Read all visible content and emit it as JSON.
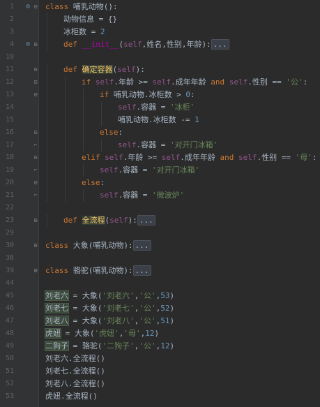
{
  "editor": {
    "lines": [
      {
        "n": "1",
        "icon": "override",
        "fold": "minus",
        "indent": 0,
        "tokens": [
          {
            "t": "class ",
            "c": "kw"
          },
          {
            "t": "哺乳动物",
            "c": "plain"
          },
          {
            "t": "():",
            "c": "plain"
          }
        ]
      },
      {
        "n": "2",
        "indent": 1,
        "tokens": [
          {
            "t": "动物信息",
            "c": "plain"
          },
          {
            "t": " = {}",
            "c": "plain"
          }
        ]
      },
      {
        "n": "3",
        "indent": 1,
        "tokens": [
          {
            "t": "冰柜数",
            "c": "plain"
          },
          {
            "t": " = ",
            "c": "plain"
          },
          {
            "t": "2",
            "c": "num"
          }
        ]
      },
      {
        "n": "4",
        "icon": "override",
        "fold": "plus",
        "indent": 1,
        "tokens": [
          {
            "t": "def ",
            "c": "kw"
          },
          {
            "t": "__init__",
            "c": "magic"
          },
          {
            "t": "(",
            "c": "plain"
          },
          {
            "t": "self",
            "c": "self"
          },
          {
            "t": ",姓名,性别,年龄):",
            "c": "plain"
          },
          {
            "t": "...",
            "c": "folded"
          }
        ]
      },
      {
        "n": "10",
        "indent": 0,
        "tokens": []
      },
      {
        "n": "11",
        "fold": "minus",
        "indent": 1,
        "tokens": [
          {
            "t": "def ",
            "c": "kw"
          },
          {
            "t": "确定容器",
            "c": "fn"
          },
          {
            "t": "(",
            "c": "plain"
          },
          {
            "t": "self",
            "c": "self"
          },
          {
            "t": "):",
            "c": "plain"
          }
        ]
      },
      {
        "n": "12",
        "fold": "minus",
        "indent": 2,
        "tokens": [
          {
            "t": "if ",
            "c": "kw"
          },
          {
            "t": "self",
            "c": "self"
          },
          {
            "t": ".年龄 >= ",
            "c": "plain"
          },
          {
            "t": "self",
            "c": "self"
          },
          {
            "t": ".成年年龄 ",
            "c": "plain"
          },
          {
            "t": "and ",
            "c": "kw"
          },
          {
            "t": "self",
            "c": "self"
          },
          {
            "t": ".性别 == ",
            "c": "plain"
          },
          {
            "t": "'公'",
            "c": "str"
          },
          {
            "t": ":",
            "c": "plain"
          }
        ]
      },
      {
        "n": "13",
        "fold": "minus",
        "indent": 3,
        "tokens": [
          {
            "t": "if ",
            "c": "kw"
          },
          {
            "t": "哺乳动物.冰柜数 > ",
            "c": "plain"
          },
          {
            "t": "0",
            "c": "num"
          },
          {
            "t": ":",
            "c": "plain"
          }
        ]
      },
      {
        "n": "14",
        "indent": 4,
        "tokens": [
          {
            "t": "self",
            "c": "self"
          },
          {
            "t": ".容器 = ",
            "c": "plain"
          },
          {
            "t": "'冰柜'",
            "c": "str"
          }
        ]
      },
      {
        "n": "15",
        "indent": 4,
        "tokens": [
          {
            "t": "哺乳动物.冰柜数 -= ",
            "c": "plain"
          },
          {
            "t": "1",
            "c": "num"
          }
        ]
      },
      {
        "n": "16",
        "fold": "minus",
        "indent": 3,
        "tokens": [
          {
            "t": "else",
            "c": "kw"
          },
          {
            "t": ":",
            "c": "plain"
          }
        ]
      },
      {
        "n": "17",
        "fold": "end",
        "indent": 4,
        "tokens": [
          {
            "t": "self",
            "c": "self"
          },
          {
            "t": ".容器 = ",
            "c": "plain"
          },
          {
            "t": "'对开门冰箱'",
            "c": "str"
          }
        ]
      },
      {
        "n": "18",
        "fold": "minus",
        "indent": 2,
        "tokens": [
          {
            "t": "elif ",
            "c": "kw"
          },
          {
            "t": "self",
            "c": "self"
          },
          {
            "t": ".年龄 >= ",
            "c": "plain"
          },
          {
            "t": "self",
            "c": "self"
          },
          {
            "t": ".成年年龄 ",
            "c": "plain"
          },
          {
            "t": "and ",
            "c": "kw"
          },
          {
            "t": "self",
            "c": "self"
          },
          {
            "t": ".性别 == ",
            "c": "plain"
          },
          {
            "t": "'母'",
            "c": "str"
          },
          {
            "t": ":",
            "c": "plain"
          }
        ]
      },
      {
        "n": "19",
        "fold": "end",
        "indent": 3,
        "tokens": [
          {
            "t": "self",
            "c": "self"
          },
          {
            "t": ".容器 = ",
            "c": "plain"
          },
          {
            "t": "'对开门冰箱'",
            "c": "str"
          }
        ]
      },
      {
        "n": "20",
        "fold": "minus",
        "indent": 2,
        "tokens": [
          {
            "t": "else",
            "c": "kw"
          },
          {
            "t": ":",
            "c": "plain"
          }
        ]
      },
      {
        "n": "21",
        "fold": "end",
        "indent": 3,
        "tokens": [
          {
            "t": "self",
            "c": "self"
          },
          {
            "t": ".容器 = ",
            "c": "plain"
          },
          {
            "t": "'微波炉'",
            "c": "str"
          }
        ]
      },
      {
        "n": "22",
        "indent": 0,
        "tokens": []
      },
      {
        "n": "23",
        "fold": "plus",
        "indent": 1,
        "tokens": [
          {
            "t": "def ",
            "c": "kw"
          },
          {
            "t": "全流程",
            "c": "fn"
          },
          {
            "t": "(",
            "c": "plain"
          },
          {
            "t": "self",
            "c": "self"
          },
          {
            "t": "):",
            "c": "plain"
          },
          {
            "t": "...",
            "c": "folded"
          }
        ]
      },
      {
        "n": "29",
        "indent": 0,
        "tokens": []
      },
      {
        "n": "30",
        "fold": "plus",
        "indent": 0,
        "tokens": [
          {
            "t": "class ",
            "c": "kw"
          },
          {
            "t": "大象",
            "c": "plain"
          },
          {
            "t": "(哺乳动物):",
            "c": "plain"
          },
          {
            "t": "...",
            "c": "folded"
          }
        ]
      },
      {
        "n": "38",
        "indent": 0,
        "tokens": []
      },
      {
        "n": "39",
        "fold": "plus",
        "indent": 0,
        "tokens": [
          {
            "t": "class ",
            "c": "kw"
          },
          {
            "t": "骆驼",
            "c": "plain"
          },
          {
            "t": "(哺乳动物):",
            "c": "plain"
          },
          {
            "t": "...",
            "c": "folded"
          }
        ]
      },
      {
        "n": "44",
        "indent": 0,
        "tokens": []
      },
      {
        "n": "45",
        "indent": 0,
        "tokens": [
          {
            "t": "刘老六",
            "c": "plain"
          },
          {
            "t": " = 大象(",
            "c": "plain"
          },
          {
            "t": "'刘老六'",
            "c": "str"
          },
          {
            "t": ",",
            "c": "plain"
          },
          {
            "t": "'公'",
            "c": "str"
          },
          {
            "t": ",",
            "c": "plain"
          },
          {
            "t": "53",
            "c": "num"
          },
          {
            "t": ")",
            "c": "plain"
          }
        ]
      },
      {
        "n": "46",
        "indent": 0,
        "tokens": [
          {
            "t": "刘老七",
            "c": "plain"
          },
          {
            "t": " = 大象(",
            "c": "plain"
          },
          {
            "t": "'刘老七'",
            "c": "str"
          },
          {
            "t": ",",
            "c": "plain"
          },
          {
            "t": "'公'",
            "c": "str"
          },
          {
            "t": ",",
            "c": "plain"
          },
          {
            "t": "52",
            "c": "num"
          },
          {
            "t": ")",
            "c": "plain"
          }
        ]
      },
      {
        "n": "47",
        "indent": 0,
        "tokens": [
          {
            "t": "刘老八",
            "c": "plain"
          },
          {
            "t": " = 大象(",
            "c": "plain"
          },
          {
            "t": "'刘老八'",
            "c": "str"
          },
          {
            "t": ",",
            "c": "plain"
          },
          {
            "t": "'公'",
            "c": "str"
          },
          {
            "t": ",",
            "c": "plain"
          },
          {
            "t": "51",
            "c": "num"
          },
          {
            "t": ")",
            "c": "plain"
          }
        ]
      },
      {
        "n": "48",
        "indent": 0,
        "tokens": [
          {
            "t": "虎妞",
            "c": "plain"
          },
          {
            "t": " = 大象(",
            "c": "plain"
          },
          {
            "t": "'虎妞'",
            "c": "str"
          },
          {
            "t": ",",
            "c": "plain"
          },
          {
            "t": "'母'",
            "c": "str"
          },
          {
            "t": ",",
            "c": "plain"
          },
          {
            "t": "12",
            "c": "num"
          },
          {
            "t": ")",
            "c": "plain"
          }
        ]
      },
      {
        "n": "49",
        "indent": 0,
        "tokens": [
          {
            "t": "二狗子",
            "c": "plain"
          },
          {
            "t": " = 骆驼(",
            "c": "plain"
          },
          {
            "t": "'二狗子'",
            "c": "str"
          },
          {
            "t": ",",
            "c": "plain"
          },
          {
            "t": "'公'",
            "c": "str"
          },
          {
            "t": ",",
            "c": "plain"
          },
          {
            "t": "12",
            "c": "num"
          },
          {
            "t": ")",
            "c": "plain"
          }
        ]
      },
      {
        "n": "50",
        "indent": 0,
        "tokens": [
          {
            "t": "刘老六.全流程()",
            "c": "plain"
          }
        ]
      },
      {
        "n": "51",
        "indent": 0,
        "tokens": [
          {
            "t": "刘老七.全流程()",
            "c": "plain"
          }
        ]
      },
      {
        "n": "52",
        "indent": 0,
        "tokens": [
          {
            "t": "刘老八.全流程()",
            "c": "plain"
          }
        ]
      },
      {
        "n": "53",
        "indent": 0,
        "tokens": [
          {
            "t": "虎妞.全流程()",
            "c": "plain"
          }
        ]
      }
    ]
  },
  "icons": {
    "override": "override-marker-icon",
    "plus": "fold-expand-icon",
    "minus": "fold-collapse-icon",
    "end": "fold-end-icon"
  },
  "colors": {
    "background": "#2b2b2b",
    "keyword": "#cc7832",
    "self": "#94558d",
    "string": "#6a8759",
    "number": "#6897bb",
    "function": "#ffc66d",
    "magic": "#b200b2"
  }
}
